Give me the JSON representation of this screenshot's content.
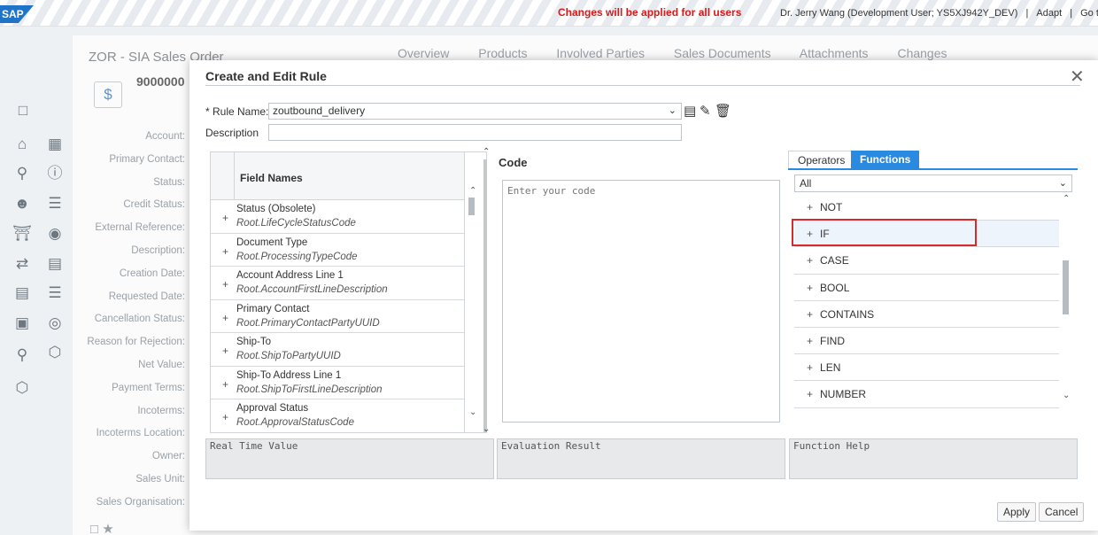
{
  "shell": {
    "logo": "SAP",
    "warning": "Changes will be applied for all users",
    "user": "Dr. Jerry Wang (Development User; YS5XJ942Y_DEV)",
    "separator": "|",
    "adapt": "Adapt",
    "goto": "Go to SAP"
  },
  "background": {
    "title": "ZOR - SIA Sales Order",
    "number": "9000000",
    "tabs": [
      "Overview",
      "Products",
      "Involved Parties",
      "Sales Documents",
      "Attachments",
      "Changes"
    ],
    "labels": [
      "Account:",
      "Primary Contact:",
      "Status:",
      "Credit Status:",
      "External Reference:",
      "Description:",
      "Creation Date:",
      "Requested Date:",
      "Cancellation Status:",
      "Reason for Rejection:",
      "Net Value:",
      "Payment Terms:",
      "Incoterms:",
      "Incoterms Location:",
      "Owner:",
      "Sales Unit:",
      "Sales Organisation:"
    ]
  },
  "dialog": {
    "title": "Create and Edit Rule",
    "rule_name_label": "* Rule Name:",
    "rule_name_value": "zoutbound_delivery",
    "description_label": "Description",
    "description_value": "",
    "field_names_header": "Field Names",
    "fields": [
      {
        "name": "Status (Obsolete)",
        "path": "Root.LifeCycleStatusCode"
      },
      {
        "name": "Document Type",
        "path": "Root.ProcessingTypeCode"
      },
      {
        "name": "Account Address Line 1",
        "path": "Root.AccountFirstLineDescription"
      },
      {
        "name": "Primary Contact",
        "path": "Root.PrimaryContactPartyUUID"
      },
      {
        "name": "Ship-To",
        "path": "Root.ShipToPartyUUID"
      },
      {
        "name": "Ship-To Address Line 1",
        "path": "Root.ShipToFirstLineDescription"
      },
      {
        "name": "Approval Status",
        "path": "Root.ApprovalStatusCode"
      }
    ],
    "code_title": "Code",
    "code_placeholder": "Enter your code",
    "tab_operators": "Operators",
    "tab_functions": "Functions",
    "function_filter": "All",
    "functions": [
      "NOT",
      "IF",
      "CASE",
      "BOOL",
      "CONTAINS",
      "FIND",
      "LEN",
      "NUMBER"
    ],
    "real_time_value": "Real Time Value",
    "evaluation_result": "Evaluation Result",
    "function_help": "Function Help",
    "apply": "Apply",
    "cancel": "Cancel"
  }
}
